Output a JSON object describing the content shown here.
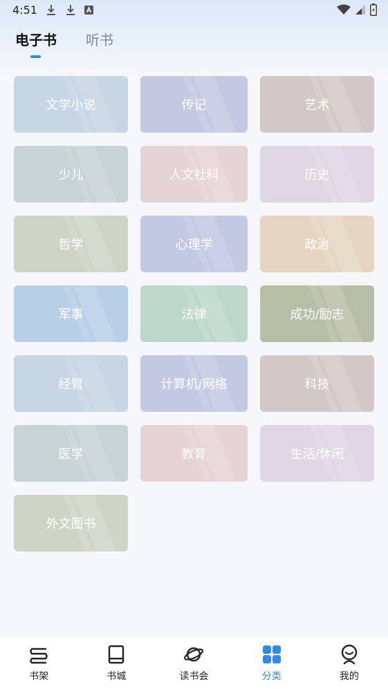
{
  "status": {
    "time": "4:51"
  },
  "tabs": [
    {
      "label": "电子书",
      "active": true
    },
    {
      "label": "听书",
      "active": false
    }
  ],
  "categories": [
    {
      "label": "文学小说",
      "color": "#c6d6e4"
    },
    {
      "label": "传记",
      "color": "#c4c9e1"
    },
    {
      "label": "艺术",
      "color": "#d2c8c6"
    },
    {
      "label": "少儿",
      "color": "#c7d3d4"
    },
    {
      "label": "人文社科",
      "color": "#e6d3d4"
    },
    {
      "label": "历史",
      "color": "#e0d6e5"
    },
    {
      "label": "哲学",
      "color": "#cfd4c6"
    },
    {
      "label": "心理学",
      "color": "#c4c9e3"
    },
    {
      "label": "政治",
      "color": "#e5d5c1"
    },
    {
      "label": "军事",
      "color": "#b8cfe8"
    },
    {
      "label": "法律",
      "color": "#bcd8cb"
    },
    {
      "label": "成功/励志",
      "color": "#b8bda6"
    },
    {
      "label": "经管",
      "color": "#c6d6e4"
    },
    {
      "label": "计算机/网络",
      "color": "#c4c9e3"
    },
    {
      "label": "科技",
      "color": "#d2c8c6"
    },
    {
      "label": "医学",
      "color": "#c7d3d4"
    },
    {
      "label": "教育",
      "color": "#e6d3d4"
    },
    {
      "label": "生活/休闲",
      "color": "#e0d6e5"
    },
    {
      "label": "外文图书",
      "color": "#cfd4c6"
    }
  ],
  "nav": [
    {
      "label": "书架",
      "icon": "bookshelf-icon",
      "active": false
    },
    {
      "label": "书城",
      "icon": "book-icon",
      "active": false
    },
    {
      "label": "读书会",
      "icon": "planet-icon",
      "active": false
    },
    {
      "label": "分类",
      "icon": "category-grid-icon",
      "active": true
    },
    {
      "label": "我的",
      "icon": "profile-icon",
      "active": false
    }
  ],
  "colors": {
    "accent": "#2f8ae8",
    "nav_inactive": "#222222"
  }
}
